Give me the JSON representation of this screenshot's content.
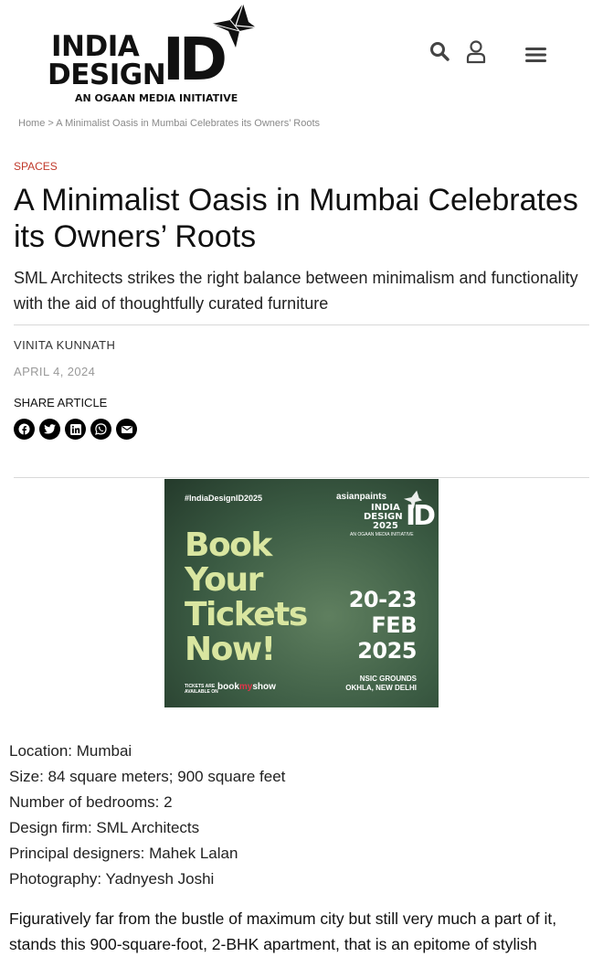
{
  "header": {
    "logo": {
      "line1": "INDIA",
      "line2": "DESIGN",
      "mark": "ID",
      "tagline": "AN OGAAN MEDIA INITIATIVE"
    },
    "icons": [
      "search-icon",
      "user-icon",
      "menu-icon"
    ]
  },
  "breadcrumb": {
    "home": "Home",
    "separator": ">",
    "current": "A Minimalist Oasis in Mumbai Celebrates its Owners’ Roots"
  },
  "article": {
    "category": "SPACES",
    "title": "A Minimalist Oasis in Mumbai Celebrates its Owners’ Roots",
    "subtitle": "SML Architects strikes the right balance between minimalism and functionality with the aid of thoughtfully curated furniture",
    "author": "VINITA KUNNATH",
    "date": "APRIL 4, 2024",
    "share_label": "SHARE ARTICLE",
    "share_icons": [
      "facebook-icon",
      "twitter-icon",
      "linkedin-icon",
      "whatsapp-icon",
      "email-icon"
    ],
    "facts": [
      "Location: Mumbai",
      "Size: 84 square meters; 900 square feet",
      "Number of bedrooms: 2",
      "Design firm: SML Architects",
      "Principal designers: Mahek Lalan",
      "Photography: Yadnyesh Joshi"
    ],
    "body": "Figuratively far from the bustle of maximum city but still very much a part of it, stands this 900-square-foot, 2-BHK apartment, that is an epitome of stylish"
  },
  "ad": {
    "hashtag": "#IndiaDesignID2025",
    "sponsor": "asianpaints",
    "logo_line1": "INDIA",
    "logo_line2": "DESIGN",
    "logo_line3": "2025",
    "logo_mark": "ID",
    "logo_tagline": "AN OGAAN MEDIA INITIATIVE",
    "headline": [
      "Book",
      "Your",
      "Tickets",
      "Now!"
    ],
    "dates_line1": "20-23",
    "dates_line2": "FEB",
    "dates_line3": "2025",
    "venue_line1": "NSIC GROUNDS",
    "venue_line2": "OKHLA, NEW DELHI",
    "tickets_line1": "TICKETS ARE",
    "tickets_line2": "AVAILABLE ON",
    "ticket_partner_a": "book",
    "ticket_partner_b": "my",
    "ticket_partner_c": "show"
  },
  "colors": {
    "category": "#c0392b",
    "ad_background": "#3b5b43",
    "ad_headline": "#d9e6a0"
  }
}
